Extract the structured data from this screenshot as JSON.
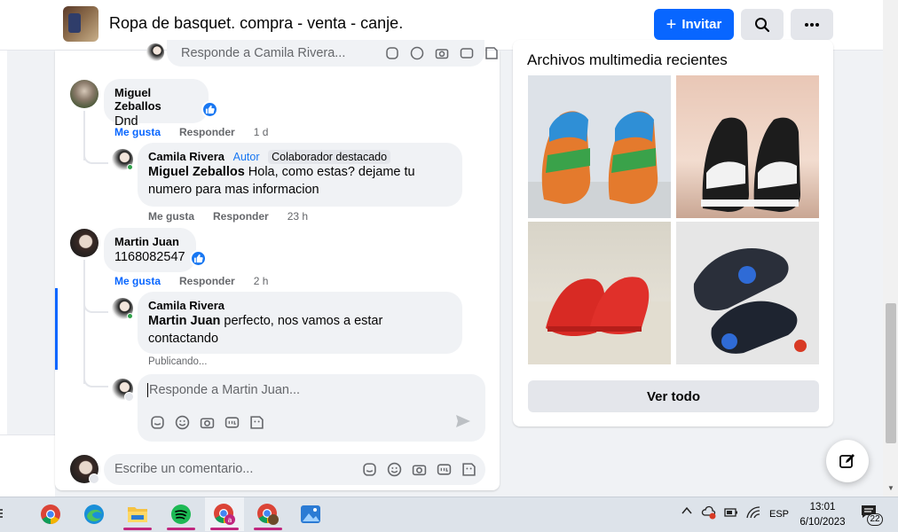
{
  "header": {
    "group_title": "Ropa de basquet. compra - venta - canje.",
    "invite_label": "Invitar"
  },
  "feed": {
    "top_reply_placeholder": "Responde a Camila Rivera...",
    "comments": [
      {
        "author": "Miguel Zeballos",
        "text": "Dnd",
        "like_label": "Me gusta",
        "reply_label": "Responder",
        "time": "1 d",
        "reply": {
          "author": "Camila Rivera",
          "tag_author": "Autor",
          "tag_badge": "Colaborador destacado",
          "mention": "Miguel Zeballos",
          "text": " Hola, como estas? dejame tu numero para mas informacion",
          "like_label": "Me gusta",
          "reply_label": "Responder",
          "time": "23 h"
        }
      },
      {
        "author": "Martin Juan",
        "text": "1168082547",
        "like_label": "Me gusta",
        "reply_label": "Responder",
        "time": "2 h",
        "reply": {
          "author": "Camila Rivera",
          "mention": "Martin Juan",
          "text": " perfecto, nos vamos a estar contactando",
          "status": "Publicando..."
        }
      }
    ],
    "reply_placeholder": "Responde a Martin Juan...",
    "comment_placeholder": "Escribe un comentario..."
  },
  "media": {
    "title": "Archivos multimedia recientes",
    "see_all_label": "Ver todo"
  },
  "taskbar": {
    "language": "ESP",
    "time": "13:01",
    "date": "6/10/2023",
    "notification_count": "22"
  },
  "colors": {
    "brand_blue": "#0866ff",
    "like_blue": "#1877f2",
    "author_tag": "#1877f2"
  }
}
